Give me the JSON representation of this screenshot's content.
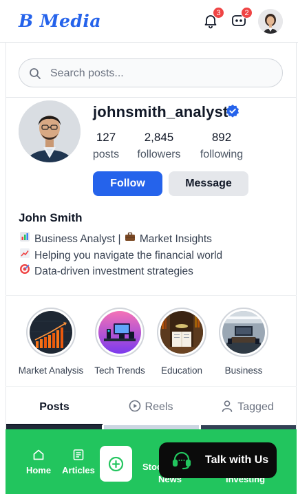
{
  "app": {
    "logo": "B Media"
  },
  "header": {
    "notifications_count": "3",
    "messages_count": "2"
  },
  "search": {
    "placeholder": "Search posts..."
  },
  "profile": {
    "username": "johnsmith_analyst",
    "verified": true,
    "stats": [
      {
        "value": "127",
        "label": "posts"
      },
      {
        "value": "2,845",
        "label": "followers"
      },
      {
        "value": "892",
        "label": "following"
      }
    ],
    "follow_label": "Follow",
    "message_label": "Message",
    "full_name": "John Smith",
    "bio": [
      {
        "icon": "chart-emoji-icon",
        "text": "Business Analyst | ",
        "icon2": "briefcase-emoji-icon",
        "text2": "Market Insights"
      },
      {
        "icon": "trend-emoji-icon",
        "text": "Helping you navigate the financial world"
      },
      {
        "icon": "target-emoji-icon",
        "text": "Data-driven investment strategies"
      }
    ]
  },
  "highlights": [
    {
      "label": "Market Analysis"
    },
    {
      "label": "Tech Trends"
    },
    {
      "label": "Education"
    },
    {
      "label": "Business"
    }
  ],
  "tabs": [
    {
      "label": "Posts",
      "icon": "none",
      "active": true
    },
    {
      "label": "Reels",
      "icon": "play-circle-icon",
      "active": false
    },
    {
      "label": "Tagged",
      "icon": "person-icon",
      "active": false
    }
  ],
  "bottom_nav": {
    "home_label": "Home",
    "articles_label": "Articles",
    "stocks_partial": "Stoc",
    "news_partial": "News",
    "investing_partial": "Investing",
    "talk_label": "Talk with Us"
  },
  "colors": {
    "brand": "#2563eb",
    "nav_green": "#22c55e",
    "badge_red": "#ef4444"
  }
}
